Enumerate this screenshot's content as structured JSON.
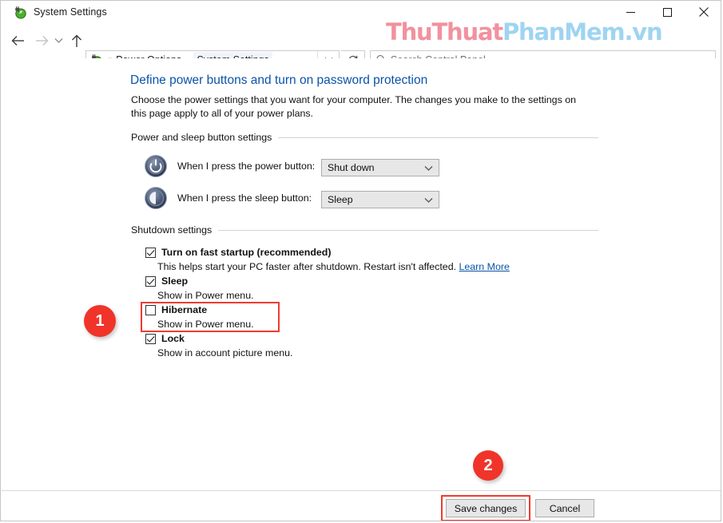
{
  "window": {
    "title": "System Settings",
    "icon": "power-plug-icon",
    "controls": {
      "minimize": "minimize-icon",
      "maximize": "maximize-icon",
      "close": "close-icon"
    }
  },
  "nav": {
    "back": "back-arrow-icon",
    "forward": "forward-arrow-icon",
    "recent": "recent-locations-chevron-icon",
    "up": "up-arrow-icon",
    "refresh": "refresh-icon",
    "address": {
      "icon": "power-plug-icon",
      "separator": "«",
      "crumb1": "Power Options",
      "crumb_arrow": "›",
      "crumb_current": "System Settings",
      "dropdown": "chevron-down-icon"
    },
    "search": {
      "icon": "search-icon",
      "placeholder": "Search Control Panel"
    }
  },
  "watermark": {
    "part1": "ThuThuat",
    "part2": "PhanMem.vn",
    "color1": "#f2919e",
    "color2": "#9ed4f2"
  },
  "main": {
    "title": "Define power buttons and turn on password protection",
    "description": "Choose the power settings that you want for your computer. The changes you make to the settings on this page apply to all of your power plans.",
    "group_power": "Power and sleep button settings",
    "group_shutdown": "Shutdown settings",
    "rows": [
      {
        "icon": "power-button-icon",
        "label": "When I press the power button:",
        "value": "Shut down"
      },
      {
        "icon": "sleep-button-icon",
        "label": "When I press the sleep button:",
        "value": "Sleep"
      }
    ],
    "checkboxes": [
      {
        "label": "Turn on fast startup (recommended)",
        "checked": true,
        "sub": "This helps start your PC faster after shutdown. Restart isn't affected.",
        "link": "Learn More"
      },
      {
        "label": "Sleep",
        "checked": true,
        "sub": "Show in Power menu.",
        "link": ""
      },
      {
        "label": "Hibernate",
        "checked": false,
        "sub": "Show in Power menu.",
        "link": ""
      },
      {
        "label": "Lock",
        "checked": true,
        "sub": "Show in account picture menu.",
        "link": ""
      }
    ]
  },
  "annotations": {
    "badge1": "1",
    "badge2": "2",
    "highlight_color": "#ef3b30"
  },
  "footer": {
    "save": "Save changes",
    "cancel": "Cancel"
  }
}
